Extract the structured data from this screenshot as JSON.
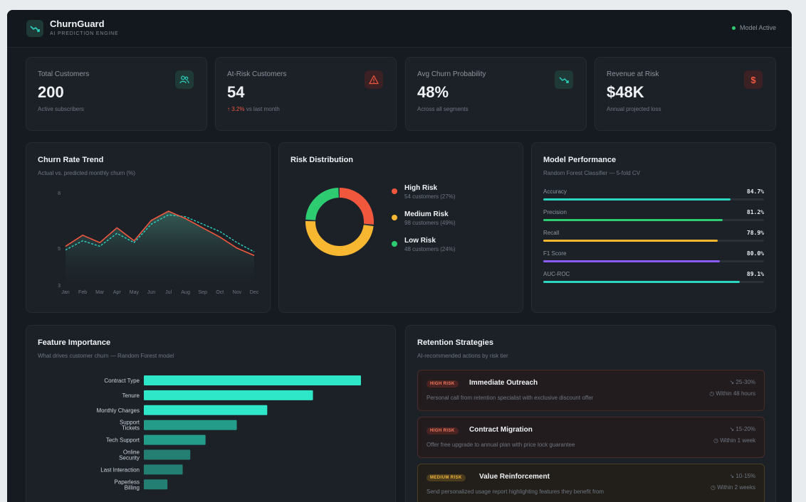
{
  "header": {
    "title": "ChurnGuard",
    "subtitle": "AI PREDICTION ENGINE",
    "status_label": "Model Active"
  },
  "kpis": [
    {
      "label": "Total Customers",
      "value": "200",
      "sub": "Active subscribers",
      "icon": "users-icon"
    },
    {
      "label": "At-Risk Customers",
      "value": "54",
      "delta": "↑ 3.2%",
      "sub": "vs last month",
      "icon": "warning-icon"
    },
    {
      "label": "Avg Churn Probability",
      "value": "48%",
      "sub": "Across all segments",
      "icon": "trend-down-icon"
    },
    {
      "label": "Revenue at Risk",
      "value": "$48K",
      "sub": "Annual projected loss",
      "icon": "dollar-icon"
    }
  ],
  "trend": {
    "title": "Churn Rate Trend",
    "subtitle": "Actual vs. predicted monthly churn (%)"
  },
  "risk": {
    "title": "Risk Distribution",
    "items": [
      {
        "name": "High Risk",
        "desc": "54 customers (27%)",
        "color": "#f0573d",
        "share": 0.27
      },
      {
        "name": "Medium Risk",
        "desc": "98 customers (49%)",
        "color": "#f7b731",
        "share": 0.49
      },
      {
        "name": "Low Risk",
        "desc": "48 customers (24%)",
        "color": "#2ecc71",
        "share": 0.24
      }
    ]
  },
  "performance": {
    "title": "Model Performance",
    "subtitle": "Random Forest Classifier — 5-fold CV",
    "metrics": [
      {
        "label": "Accuracy",
        "value": "84.7%",
        "fraction": 0.847,
        "color": "#2dd4bf"
      },
      {
        "label": "Precision",
        "value": "81.2%",
        "fraction": 0.812,
        "color": "#2ecc71"
      },
      {
        "label": "Recall",
        "value": "78.9%",
        "fraction": 0.789,
        "color": "#f7b731"
      },
      {
        "label": "F1 Score",
        "value": "80.0%",
        "fraction": 0.8,
        "color": "#8b5cf6"
      },
      {
        "label": "AUC-ROC",
        "value": "89.1%",
        "fraction": 0.891,
        "color": "#2dd4bf"
      }
    ]
  },
  "features": {
    "title": "Feature Importance",
    "subtitle": "What drives customer churn — Random Forest model"
  },
  "strategies": {
    "title": "Retention Strategies",
    "subtitle": "AI-recommended actions by risk tier",
    "items": [
      {
        "badge": "HIGH RISK",
        "level": "high",
        "title": "Immediate Outreach",
        "desc": "Personal call from retention specialist with exclusive discount offer",
        "pct": "↘ 25-30%",
        "time": "◷ Within 48 hours"
      },
      {
        "badge": "HIGH RISK",
        "level": "high",
        "title": "Contract Migration",
        "desc": "Offer free upgrade to annual plan with price lock guarantee",
        "pct": "↘ 15-20%",
        "time": "◷ Within 1 week"
      },
      {
        "badge": "MEDIUM RISK",
        "level": "med",
        "title": "Value Reinforcement",
        "desc": "Send personalized usage report highlighting features they benefit from",
        "pct": "↘ 10-15%",
        "time": "◷ Within 2 weeks"
      }
    ]
  },
  "chart_data": [
    {
      "type": "area",
      "title": "Churn Rate Trend",
      "subtitle": "Actual vs. predicted monthly churn (%)",
      "categories": [
        "Jan",
        "Feb",
        "Mar",
        "Apr",
        "May",
        "Jun",
        "Jul",
        "Aug",
        "Sep",
        "Oct",
        "Nov",
        "Dec"
      ],
      "series": [
        {
          "values": [
            5.1,
            5.7,
            5.3,
            6.1,
            5.4,
            6.5,
            7.0,
            6.6,
            6.1,
            5.6,
            5.0,
            4.6
          ],
          "color": "#f0573d"
        },
        {
          "values": [
            4.9,
            5.4,
            5.1,
            5.8,
            5.3,
            6.3,
            6.8,
            6.7,
            6.3,
            5.9,
            5.3,
            4.8
          ],
          "color": "#2dd4bf",
          "dashed": true
        }
      ],
      "yticks": [
        3,
        5,
        8
      ],
      "ylim": [
        3,
        8
      ]
    },
    {
      "type": "pie",
      "title": "Risk Distribution",
      "categories": [
        "High Risk",
        "Medium Risk",
        "Low Risk"
      ],
      "values": [
        27,
        49,
        24
      ]
    },
    {
      "type": "bar",
      "orientation": "horizontal",
      "title": "Feature Importance",
      "subtitle": "What drives customer churn — Random Forest model",
      "categories": [
        "Contract Type",
        "Tenure",
        "Monthly Charges",
        "Support Tickets",
        "Tech Support",
        "Online Security",
        "Last Interaction",
        "Paperless Billing"
      ],
      "values": [
        0.285,
        0.222,
        0.162,
        0.122,
        0.081,
        0.061,
        0.051,
        0.031
      ],
      "xticks": [
        "0",
        "0.075",
        "0.15",
        "0.225",
        "0.3"
      ],
      "xlim": [
        0,
        0.3
      ]
    }
  ]
}
